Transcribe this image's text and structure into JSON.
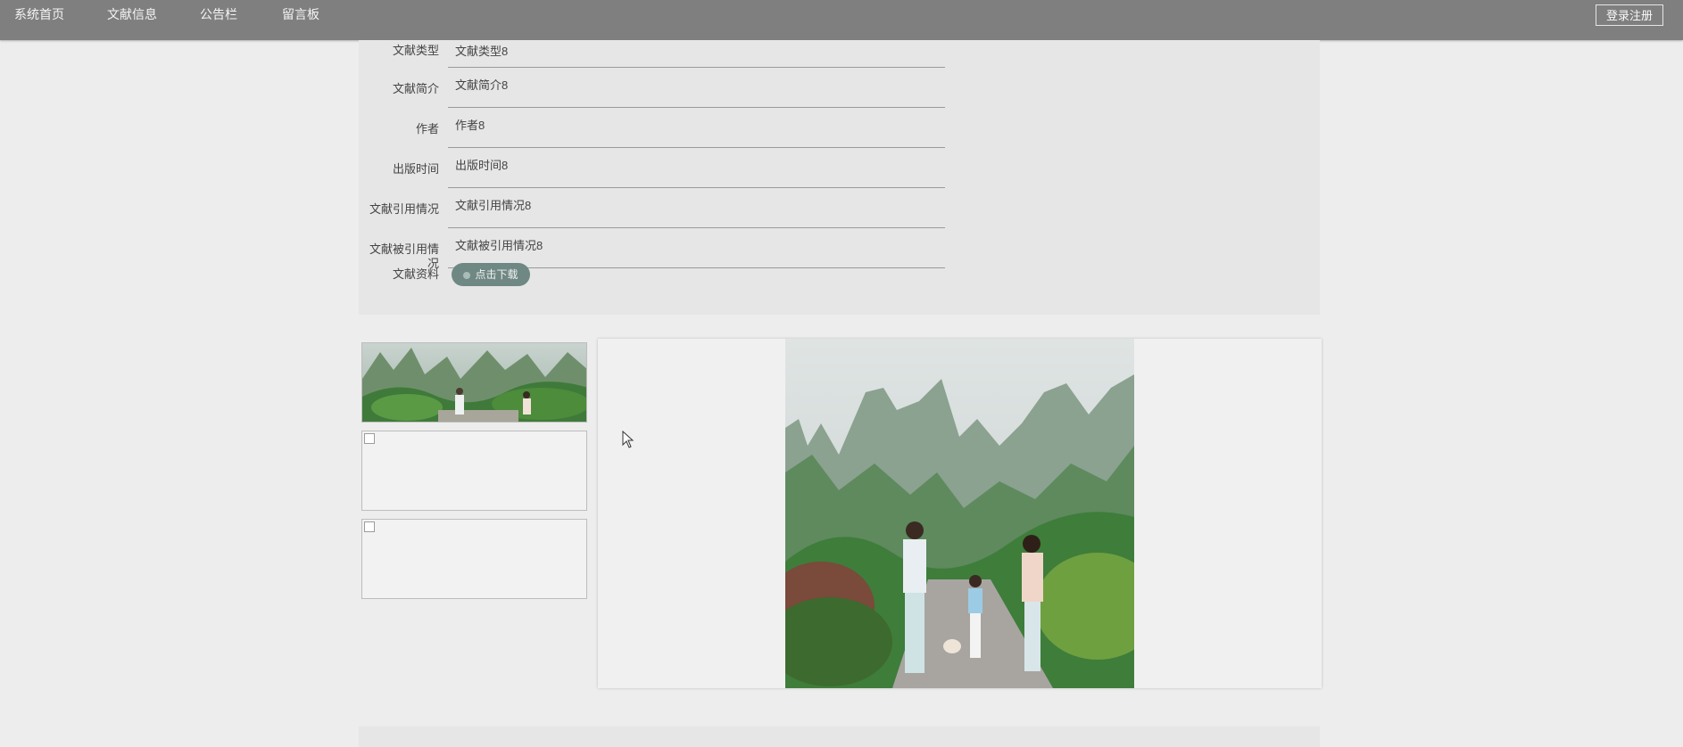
{
  "nav": {
    "items": [
      {
        "label": "系统首页"
      },
      {
        "label": "文献信息"
      },
      {
        "label": "公告栏"
      },
      {
        "label": "留言板"
      }
    ],
    "login_label": "登录注册"
  },
  "detail": {
    "rows": [
      {
        "label": "文献类型",
        "value": "文献类型8"
      },
      {
        "label": "文献简介",
        "value": "文献简介8"
      },
      {
        "label": "作者",
        "value": "作者8"
      },
      {
        "label": "出版时间",
        "value": "出版时间8"
      },
      {
        "label": "文献引用情况",
        "value": "文献引用情况8"
      },
      {
        "label": "文献被引用情况",
        "value": "文献被引用情况8"
      }
    ],
    "download_label": "文献资料",
    "download_button": "点击下载"
  },
  "colors": {
    "nav_bg": "#7f7f7f",
    "page_bg": "#ededed",
    "panel_bg": "#e6e6e6",
    "button_bg": "#6f8883"
  }
}
